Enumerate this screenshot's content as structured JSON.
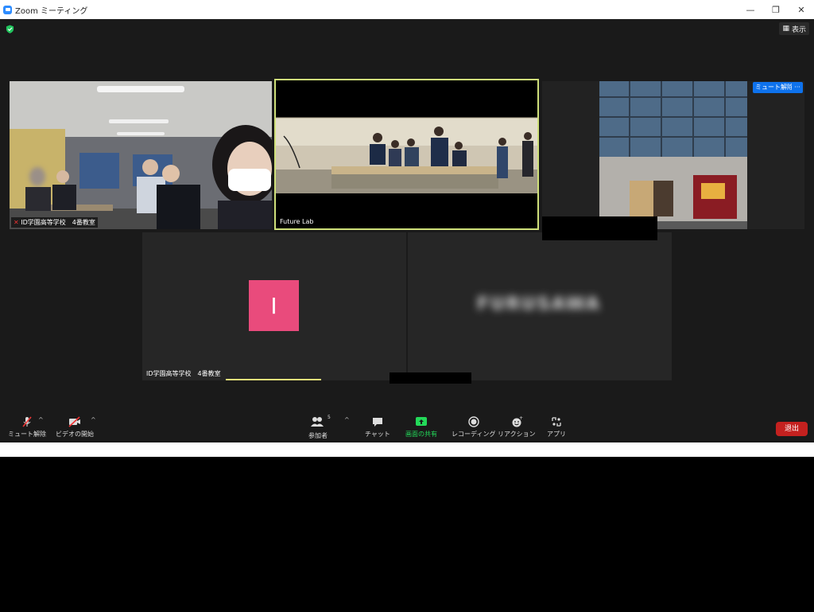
{
  "window": {
    "title": "Zoom ミーティング"
  },
  "top": {
    "view_label": "表示"
  },
  "tiles": [
    {
      "name": "ID学園高等学校　4番教室"
    },
    {
      "name": "Future Lab"
    },
    {
      "unmute_label": "ミュート解除",
      "more_label": "···"
    },
    {
      "avatar_letter": "I",
      "name": "ID学園高等学校　4番教室"
    },
    {
      "blurred_name": "FURUSAWA"
    }
  ],
  "toolbar": {
    "mute_label": "ミュート解除",
    "video_label": "ビデオの開始",
    "participants_label": "参加者",
    "participants_count": "5",
    "chat_label": "チャット",
    "share_label": "画面の共有",
    "record_label": "レコーディング",
    "reaction_label": "リアクション",
    "apps_label": "アプリ",
    "leave_label": "退出"
  },
  "colors": {
    "share_green": "#23d959",
    "leave_red": "#c4211f",
    "active_border": "#cfe07a",
    "avatar_pink": "#e94b7c"
  }
}
